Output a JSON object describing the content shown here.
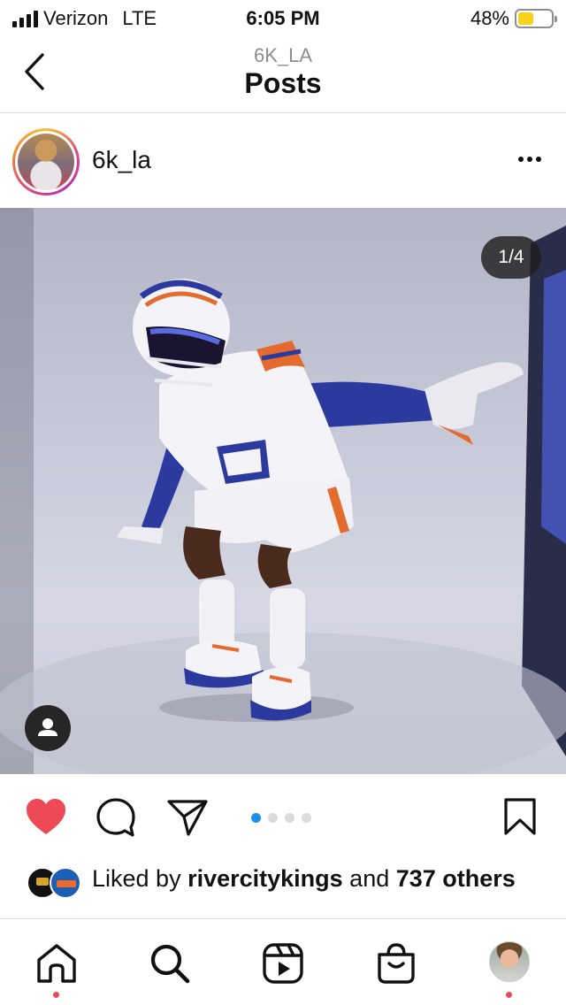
{
  "status_bar": {
    "carrier": "Verizon",
    "network": "LTE",
    "time": "6:05 PM",
    "battery_percent": "48%",
    "battery_level": 0.48,
    "battery_color": "#f7d21b"
  },
  "header": {
    "subtitle": "6K_LA",
    "title": "Posts",
    "back_icon": "chevron-left-icon"
  },
  "post": {
    "username": "6k_la",
    "more_icon": "ellipsis-icon",
    "image_counter": "1/4",
    "carousel_count": 4,
    "carousel_active_index": 0,
    "liked": true,
    "like_color": "#ed4956",
    "likes": {
      "prefix": "Liked by ",
      "user": "rivercitykings",
      "middle": " and ",
      "count": "737",
      "suffix": " others"
    }
  },
  "actions": {
    "like_icon": "heart-icon",
    "comment_icon": "comment-icon",
    "share_icon": "paper-plane-icon",
    "save_icon": "bookmark-icon"
  },
  "tab_bar": {
    "items": [
      {
        "icon": "home-icon",
        "notification": true
      },
      {
        "icon": "search-icon",
        "notification": false
      },
      {
        "icon": "reels-icon",
        "notification": false
      },
      {
        "icon": "shop-icon",
        "notification": false
      },
      {
        "icon": "profile-avatar",
        "notification": true
      }
    ]
  }
}
